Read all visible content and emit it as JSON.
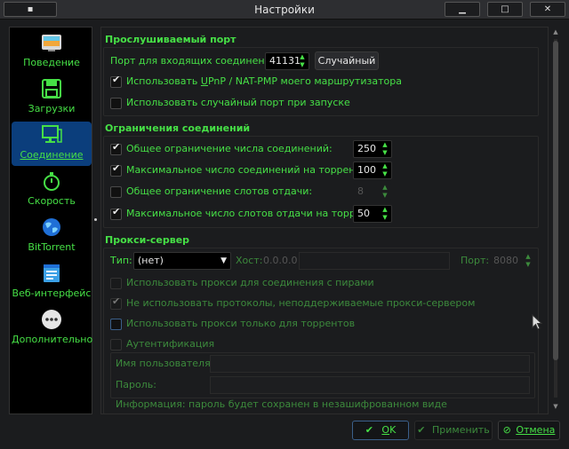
{
  "window": {
    "title": "Настройки",
    "menu_glyph": "▪",
    "minimize_glyph": "▁",
    "maximize_glyph": "□",
    "close_glyph": "✕"
  },
  "sidebar": {
    "items": [
      {
        "label": "Поведение",
        "icon": "behavior-icon"
      },
      {
        "label": "Загрузки",
        "icon": "floppy-disk-icon"
      },
      {
        "label": "Соединение",
        "icon": "network-monitor-icon",
        "active": true
      },
      {
        "label": "Скорость",
        "icon": "stopwatch-icon"
      },
      {
        "label": "BitTorrent",
        "icon": "globe-icon"
      },
      {
        "label": "Веб-интерфейс",
        "icon": "web-ui-icon"
      },
      {
        "label": "Дополнительно",
        "icon": "more-icon"
      }
    ]
  },
  "listening_port": {
    "title": "Прослушиваемый порт",
    "port_label": "Порт для входящих соединений:",
    "port_value": "41131",
    "random_button": "Случайный",
    "upnp_label_pre": "Использовать ",
    "upnp_label_u": "U",
    "upnp_label_post": "PnP / NAT-PMP моего маршрутизатора",
    "upnp_checked": true,
    "random_port_label": "Использовать случайный порт при запуске",
    "random_port_checked": false
  },
  "connection_limits": {
    "title": "Ограничения соединений",
    "global_max_label": "Общее ограничение числа соединений:",
    "global_max_value": "250",
    "global_max_checked": true,
    "per_torrent_label": "Максимальное число соединений на торрент:",
    "per_torrent_value": "100",
    "per_torrent_checked": true,
    "global_upload_slots_label": "Общее ограничение слотов отдачи:",
    "global_upload_slots_value": "8",
    "global_upload_slots_checked": false,
    "per_torrent_upload_slots_label": "Максимальное число слотов отдачи на торрент:",
    "per_torrent_upload_slots_value": "50",
    "per_torrent_upload_slots_checked": true
  },
  "proxy": {
    "title": "Прокси-сервер",
    "type_label": "Тип:",
    "type_value": "(нет)",
    "host_label": "Хост:",
    "host_placeholder": "0.0.0.0",
    "port_label": "Порт:",
    "port_value": "8080",
    "use_for_peers_label": "Использовать прокси для соединения с пирами",
    "use_for_peers_checked": false,
    "disable_unsupported_label": "Не использовать протоколы, неподдерживаемые прокси-сервером",
    "disable_unsupported_checked": true,
    "torrents_only_label": "Использовать прокси только для торрентов",
    "torrents_only_checked": false,
    "auth_label": "Аутентификация",
    "auth_checked": false,
    "username_label": "Имя пользователя:",
    "password_label": "Пароль:",
    "info_label": "Информация: пароль будет сохранен в незашифрованном виде"
  },
  "buttons": {
    "ok": "OK",
    "ok_u": "O",
    "apply": "Применить",
    "cancel": "Отмена"
  },
  "colors": {
    "accent_text": "#46e046",
    "selection": "#0b3e7c",
    "background": "#1b1c1e"
  }
}
